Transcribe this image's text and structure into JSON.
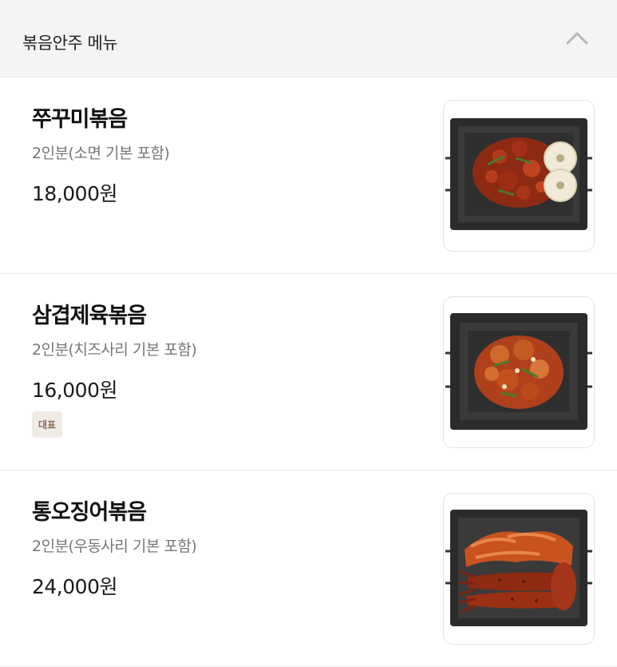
{
  "section": {
    "title": "볶음안주 메뉴",
    "collapse_icon": "chevron-up-icon"
  },
  "items": [
    {
      "name": "쭈꾸미볶음",
      "description": "2인분(소면 기본 포함)",
      "price": "18,000원",
      "badge": "",
      "image_icon": "jjukkumi-dish-photo"
    },
    {
      "name": "삼겹제육볶음",
      "description": "2인분(치즈사리 기본 포함)",
      "price": "16,000원",
      "badge": "대표",
      "image_icon": "pork-dish-photo"
    },
    {
      "name": "통오징어볶음",
      "description": "2인분(우동사리 기본 포함)",
      "price": "24,000원",
      "badge": "",
      "image_icon": "squid-dish-photo"
    }
  ],
  "colors": {
    "header_bg": "#f4f4f4",
    "badge_bg": "#f1ebe6",
    "badge_text": "#8b6e5a",
    "desc_text": "#777777"
  }
}
